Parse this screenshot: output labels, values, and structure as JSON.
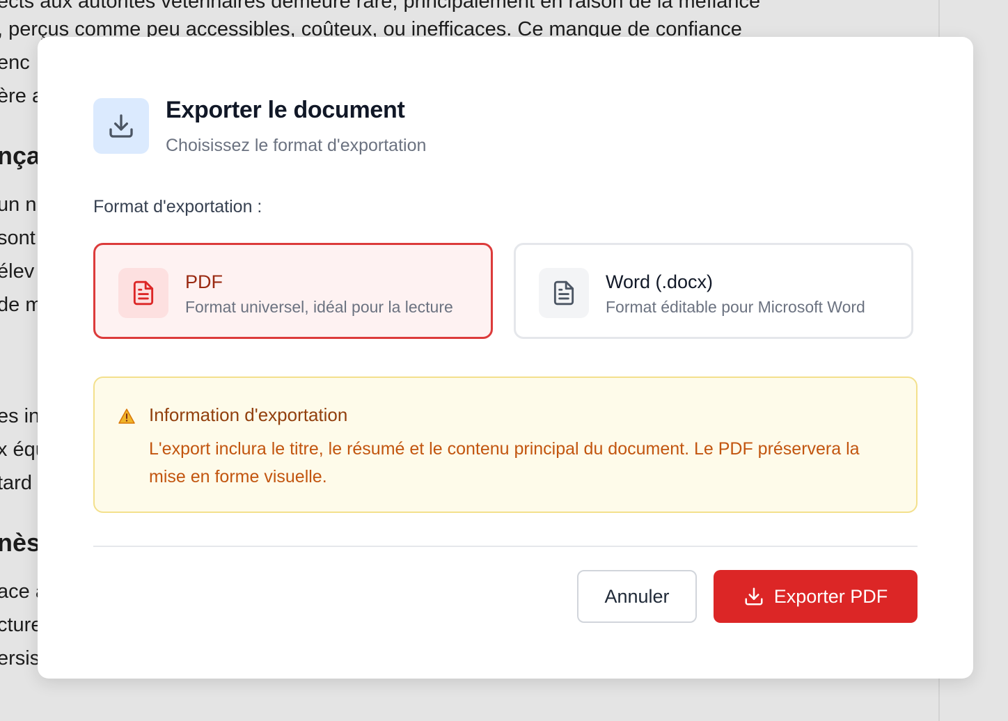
{
  "background_document": {
    "lines": [
      "ects aux autorités vétérinaires demeure rare, principalement en raison de la méfiance",
      ", perçus comme peu accessibles, coûteux, ou inefficaces. Ce manque de confiance",
      "enc",
      "ère a",
      "nça",
      "un n",
      "sont",
      "élev",
      "de m",
      "es in",
      "x équ",
      "tard",
      "nès",
      "ace a",
      "cture",
      "ersis"
    ]
  },
  "modal": {
    "header_icon": "download-icon",
    "title": "Exporter le document",
    "subtitle": "Choisissez le format d'exportation",
    "format_label": "Format d'exportation :",
    "options": [
      {
        "name": "PDF",
        "description": "Format universel, idéal pour la lecture",
        "icon": "file-text-icon",
        "selected": true
      },
      {
        "name": "Word (.docx)",
        "description": "Format éditable pour Microsoft Word",
        "icon": "file-text-icon",
        "selected": false
      }
    ],
    "info": {
      "icon": "warning-icon",
      "title": "Information d'exportation",
      "text": "L'export inclura le titre, le résumé et le contenu principal du document. Le PDF préservera la mise en forme visuelle."
    },
    "buttons": {
      "cancel_label": "Annuler",
      "export_label": "Exporter PDF",
      "export_icon": "download-icon"
    }
  },
  "colors": {
    "accent_red": "#dc2626",
    "selected_border": "#dc3b3b",
    "info_bg": "#fefbea",
    "info_text": "#c2550f",
    "header_icon_bg": "#dbeafe"
  }
}
